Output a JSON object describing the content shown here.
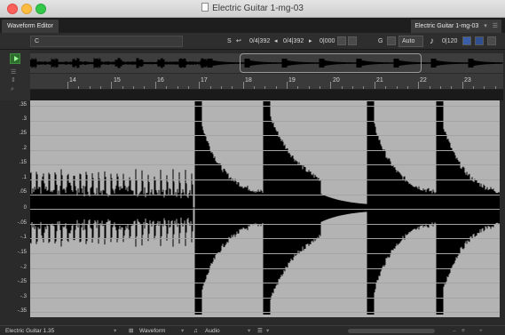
{
  "window": {
    "title": "Electric Guitar 1-mg-03"
  },
  "tabbar": {
    "tab_label": "Waveform Editor",
    "right_label": "Electric Guitar 1-mg-03"
  },
  "toolbar": {
    "c_label": "C",
    "s_label": "S",
    "pos1": "0/4|392",
    "pos2": "0/4|392",
    "offset": "0|000",
    "g_label": "G",
    "snap_value": "Auto",
    "tempo": "0|120"
  },
  "ruler": {
    "labels": [
      "14",
      "15",
      "16",
      "17",
      "18",
      "19",
      "20",
      "21",
      "22",
      "23"
    ]
  },
  "amplitude_axis": {
    "labels": [
      ".35",
      ".3",
      ".25",
      ".2",
      ".15",
      ".1",
      ".05",
      "0",
      "-.05",
      "-.1",
      "-.15",
      "-.2",
      "-.25",
      "-.3",
      "-.35"
    ]
  },
  "statusbar": {
    "track_name": "Electric Guitar 1.35",
    "view_mode": "Waveform",
    "source_mode": "Audio"
  },
  "colors": {
    "waveform": "#000000",
    "wave_bg": "#b3b3b3",
    "overview_bg": "#3d3d3d"
  }
}
